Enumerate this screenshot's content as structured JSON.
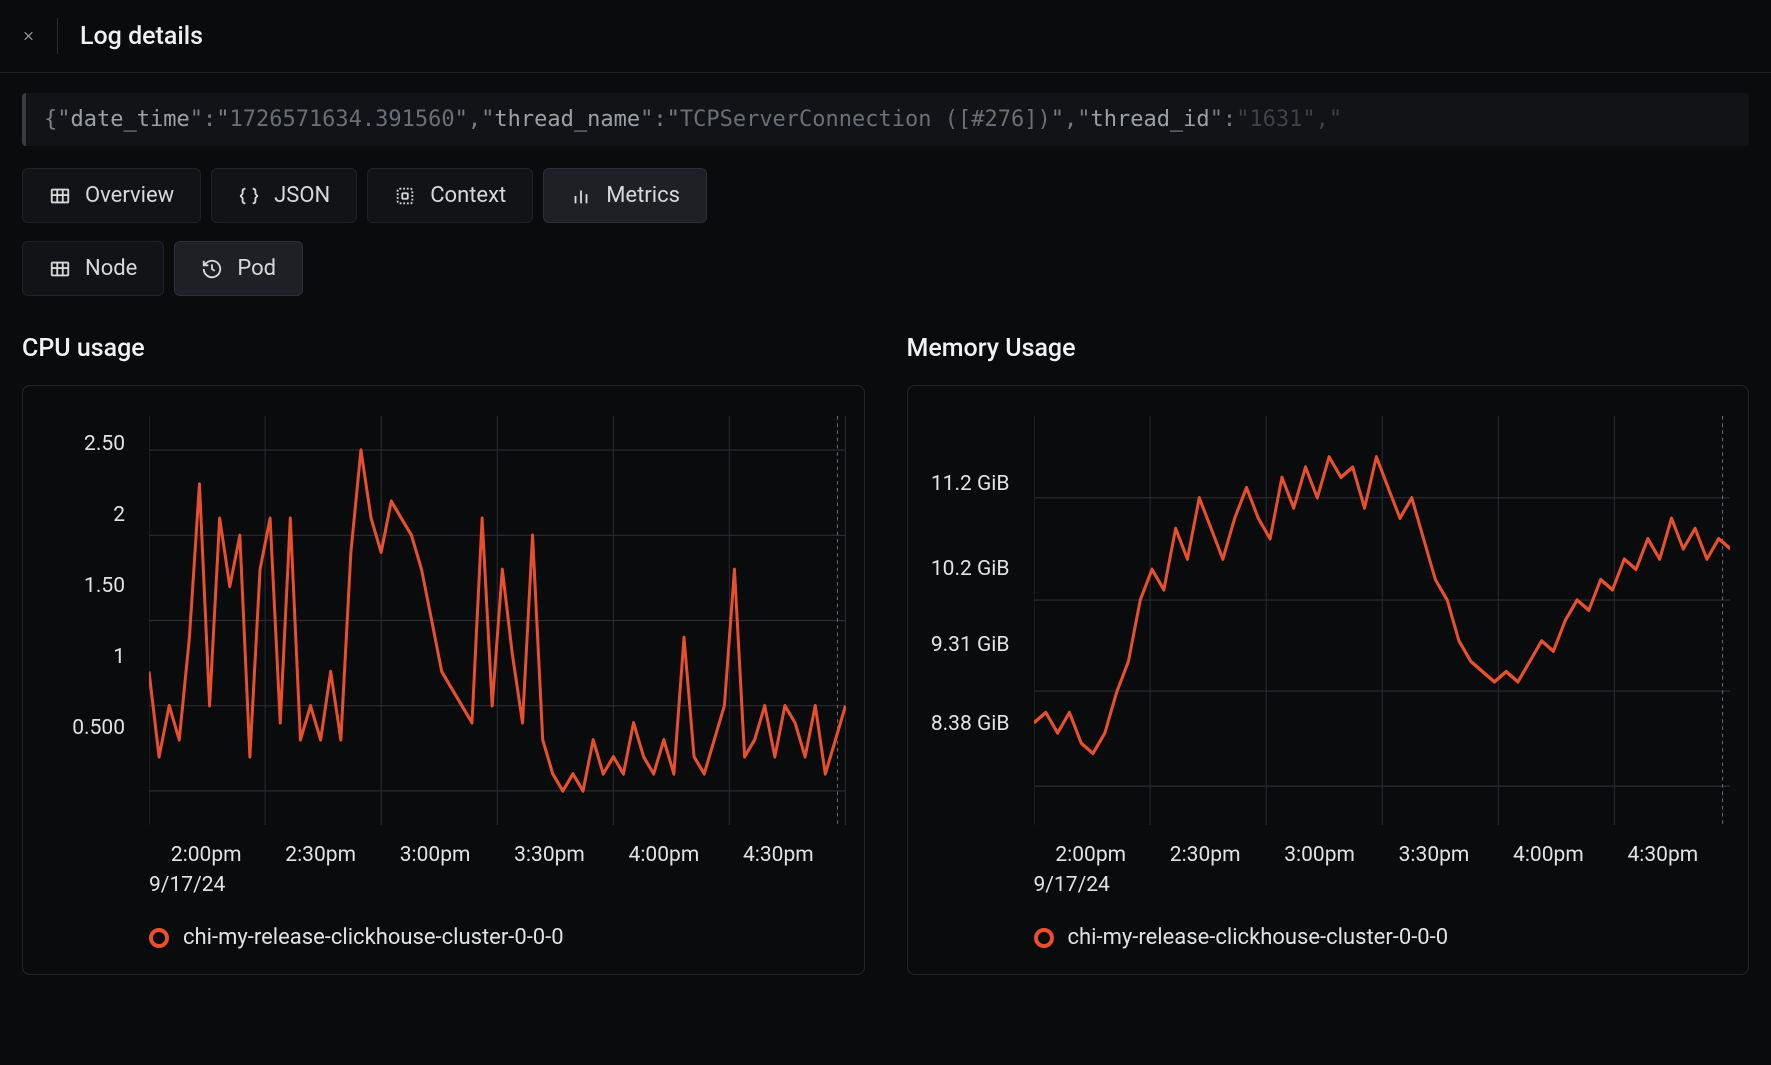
{
  "header": {
    "title": "Log details"
  },
  "log_json": {
    "date_time_key": "date_time",
    "date_time_val": "1726571634.391560",
    "thread_name_key": "thread_name",
    "thread_name_val": "TCPServerConnection ([#276])",
    "thread_id_key": "thread_id",
    "thread_id_val": "1631"
  },
  "tabs": {
    "overview": "Overview",
    "json": "JSON",
    "context": "Context",
    "metrics": "Metrics"
  },
  "subtabs": {
    "node": "Node",
    "pod": "Pod"
  },
  "cpu_chart_title": "CPU usage",
  "mem_chart_title": "Memory Usage",
  "x_date": "9/17/24",
  "legend_series": "chi-my-release-clickhouse-cluster-0-0-0",
  "colors": {
    "accent": "#e8502d"
  },
  "chart_data": [
    {
      "type": "line",
      "title": "CPU usage",
      "xlabel": "",
      "ylabel": "",
      "ylim": [
        0.3,
        2.7
      ],
      "y_ticks": [
        "2.50",
        "2",
        "1.50",
        "1",
        "0.500"
      ],
      "categories": [
        "2:00pm",
        "2:30pm",
        "3:00pm",
        "3:30pm",
        "4:00pm",
        "4:30pm"
      ],
      "series": [
        {
          "name": "chi-my-release-clickhouse-cluster-0-0-0",
          "values": [
            1.2,
            0.7,
            1.0,
            0.8,
            1.4,
            2.3,
            1.0,
            2.1,
            1.7,
            2.0,
            0.7,
            1.8,
            2.1,
            0.9,
            2.1,
            0.8,
            1.0,
            0.8,
            1.2,
            0.8,
            1.9,
            2.5,
            2.1,
            1.9,
            2.2,
            2.1,
            2.0,
            1.8,
            1.5,
            1.2,
            1.1,
            1.0,
            0.9,
            2.1,
            1.0,
            1.8,
            1.3,
            0.9,
            2.0,
            0.8,
            0.6,
            0.5,
            0.6,
            0.5,
            0.8,
            0.6,
            0.7,
            0.6,
            0.9,
            0.7,
            0.6,
            0.8,
            0.6,
            1.4,
            0.7,
            0.6,
            0.8,
            1.0,
            1.8,
            0.7,
            0.8,
            1.0,
            0.7,
            1.0,
            0.9,
            0.7,
            1.0,
            0.6,
            0.8,
            1.0
          ]
        }
      ]
    },
    {
      "type": "line",
      "title": "Memory Usage",
      "xlabel": "",
      "ylabel": "",
      "ylim": [
        8.0,
        12.0
      ],
      "y_ticks": [
        "11.2 GiB",
        "10.2 GiB",
        "9.31 GiB",
        "8.38 GiB"
      ],
      "categories": [
        "2:00pm",
        "2:30pm",
        "3:00pm",
        "3:30pm",
        "4:00pm",
        "4:30pm"
      ],
      "series": [
        {
          "name": "chi-my-release-clickhouse-cluster-0-0-0",
          "values": [
            9.0,
            9.1,
            8.9,
            9.1,
            8.8,
            8.7,
            8.9,
            9.3,
            9.6,
            10.2,
            10.5,
            10.3,
            10.9,
            10.6,
            11.2,
            10.9,
            10.6,
            11.0,
            11.3,
            11.0,
            10.8,
            11.4,
            11.1,
            11.5,
            11.2,
            11.6,
            11.4,
            11.5,
            11.1,
            11.6,
            11.3,
            11.0,
            11.2,
            10.8,
            10.4,
            10.2,
            9.8,
            9.6,
            9.5,
            9.4,
            9.5,
            9.4,
            9.6,
            9.8,
            9.7,
            10.0,
            10.2,
            10.1,
            10.4,
            10.3,
            10.6,
            10.5,
            10.8,
            10.6,
            11.0,
            10.7,
            10.9,
            10.6,
            10.8,
            10.7
          ]
        }
      ]
    }
  ]
}
